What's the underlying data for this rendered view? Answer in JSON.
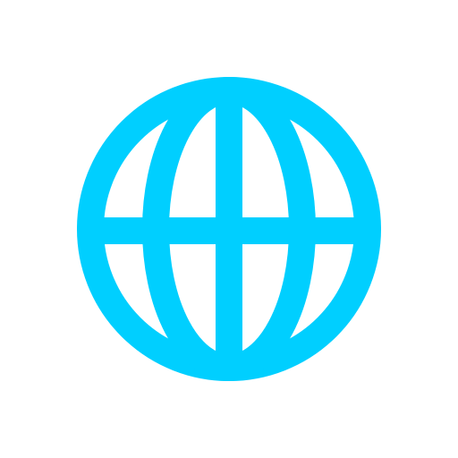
{
  "icon": {
    "name": "globe-icon",
    "color": "#00CFFF",
    "background": "#FFFFFF"
  }
}
